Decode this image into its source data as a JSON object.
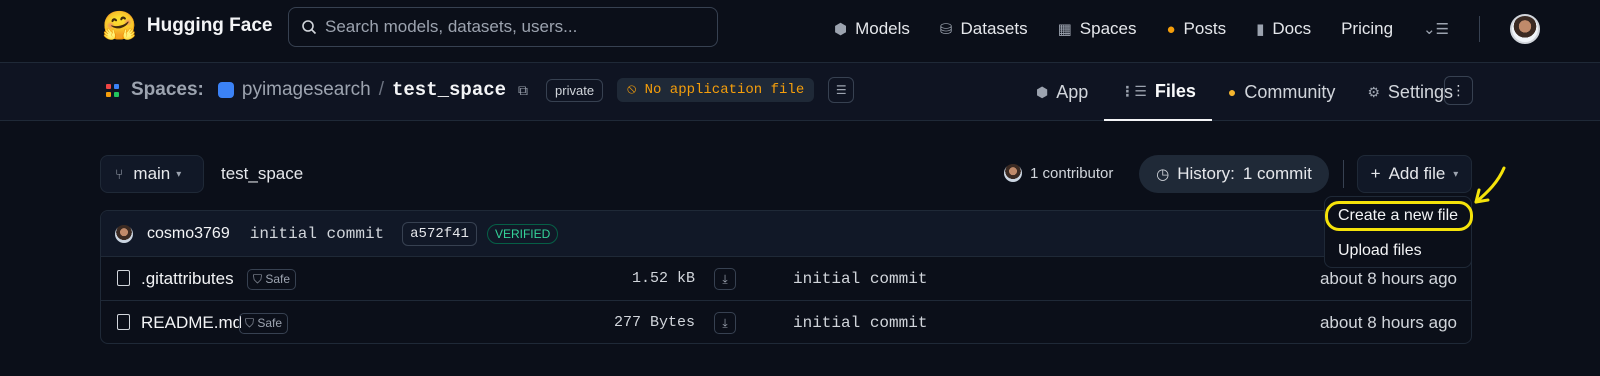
{
  "header": {
    "brand": "Hugging Face",
    "search_placeholder": "Search models, datasets, users...",
    "nav": [
      {
        "label": "Models",
        "icon": "cube-icon"
      },
      {
        "label": "Datasets",
        "icon": "database-icon"
      },
      {
        "label": "Spaces",
        "icon": "grid-icon"
      },
      {
        "label": "Posts",
        "icon": "chat-bubble-icon"
      },
      {
        "label": "Docs",
        "icon": "doc-icon"
      },
      {
        "label": "Pricing",
        "icon": ""
      }
    ]
  },
  "repo": {
    "section": "Spaces:",
    "owner": "pyimagesearch",
    "name": "test_space",
    "visibility": "private",
    "status": "No application file",
    "tabs": [
      {
        "label": "App"
      },
      {
        "label": "Files"
      },
      {
        "label": "Community"
      },
      {
        "label": "Settings"
      }
    ]
  },
  "files": {
    "branch": "main",
    "path": "test_space",
    "contributors": "1 contributor",
    "history_label": "History:",
    "history_count": "1 commit",
    "add_file_label": "Add file",
    "last_commit": {
      "user": "cosmo3769",
      "message": "initial commit",
      "sha": "a572f41",
      "badge": "VERIFIED"
    },
    "rows": [
      {
        "name": ".gitattributes",
        "safe": "Safe",
        "size": "1.52 kB",
        "message": "initial commit",
        "date": "about 8 hours ago"
      },
      {
        "name": "README.md",
        "safe": "Safe",
        "size": "277 Bytes",
        "message": "initial commit",
        "date": "about 8 hours ago"
      }
    ]
  },
  "add_file_menu": {
    "items": [
      "Create a new file",
      "Upload files"
    ]
  },
  "colors": {
    "background": "#0b0f19",
    "accent_status": "#f59e0b",
    "verified": "#34d399",
    "annotation": "#f5e30a"
  }
}
